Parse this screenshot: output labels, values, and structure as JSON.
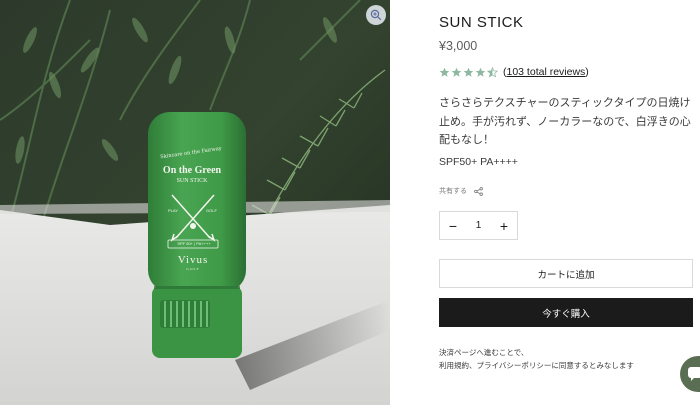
{
  "product": {
    "title": "SUN STICK",
    "price": "¥3,000",
    "rating": 4.5,
    "reviews_link": "103 total reviews",
    "description": "さらさらテクスチャーのスティックタイプの日焼け止め。手が汚れず、ノーカラーなので、白浮きの心配もなし！",
    "spf": "SPF50+ PA++++"
  },
  "packaging": {
    "tagline": "Skincare on the Fairway",
    "brand_line1": "On the Green",
    "brand_line2": "SUN STICK",
    "play_label": "PLAY",
    "golf_label": "GOLF",
    "spf_strip": "SPF 50+ | PA++++",
    "vivus": "Vivus",
    "vivus_sub": "GOLF"
  },
  "share": {
    "label": "共有する",
    "icon": "share-icon"
  },
  "quantity": {
    "minus": "−",
    "value": "1",
    "plus": "+"
  },
  "actions": {
    "add_to_cart": "カートに追加",
    "buy_now": "今すぐ購入"
  },
  "legal": "決済ページへ進むことで、\n利用規約、プライバシーポリシーに同意するとみなします",
  "colors": {
    "star": "#8fb8a3",
    "primary_button": "#1c1b1b",
    "package_green": "#3f9a47",
    "chat_bubble": "#5a6e53"
  },
  "icons": {
    "zoom": "zoom-in-icon",
    "chat": "chat-icon"
  }
}
